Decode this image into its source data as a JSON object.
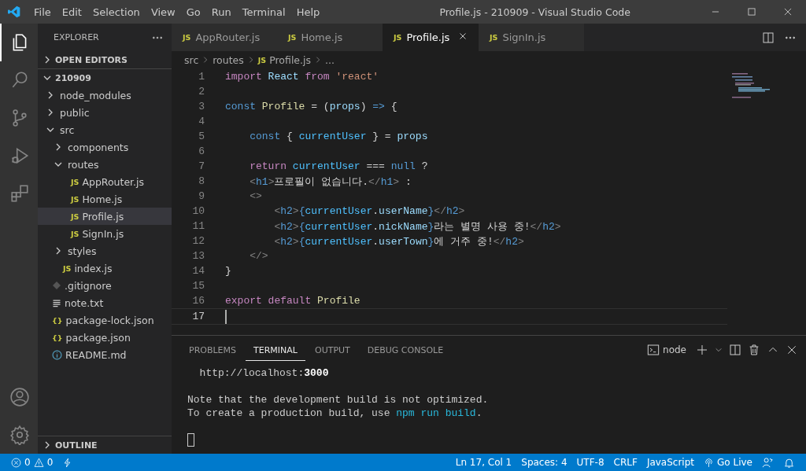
{
  "window": {
    "title": "Profile.js - 210909 - Visual Studio Code"
  },
  "menu": [
    "File",
    "Edit",
    "Selection",
    "View",
    "Go",
    "Run",
    "Terminal",
    "Help"
  ],
  "activity_bar": [
    {
      "kind": "files",
      "selected": true
    },
    {
      "kind": "search",
      "selected": false
    },
    {
      "kind": "source-control",
      "selected": false
    },
    {
      "kind": "run",
      "selected": false
    },
    {
      "kind": "extensions",
      "selected": false
    }
  ],
  "activity_bottom": [
    {
      "kind": "account"
    },
    {
      "kind": "settings"
    }
  ],
  "sidebar": {
    "title": "EXPLORER",
    "sections": [
      {
        "label": "OPEN EDITORS",
        "expanded": false
      }
    ],
    "root": {
      "label": "210909",
      "expanded": true,
      "children": [
        {
          "label": "node_modules",
          "kind": "folder",
          "expanded": false,
          "selected": false
        },
        {
          "label": "public",
          "kind": "folder",
          "expanded": false,
          "selected": false
        },
        {
          "label": "src",
          "kind": "folder",
          "expanded": true,
          "selected": false,
          "children": [
            {
              "label": "components",
              "kind": "folder",
              "expanded": false,
              "selected": false
            },
            {
              "label": "routes",
              "kind": "folder",
              "expanded": true,
              "selected": false,
              "children": [
                {
                  "label": "AppRouter.js",
                  "kind": "js",
                  "badge": "JS",
                  "selected": false
                },
                {
                  "label": "Home.js",
                  "kind": "js",
                  "badge": "JS",
                  "selected": false
                },
                {
                  "label": "Profile.js",
                  "kind": "js",
                  "badge": "JS",
                  "selected": true
                },
                {
                  "label": "SignIn.js",
                  "kind": "js",
                  "badge": "JS",
                  "selected": false
                }
              ]
            },
            {
              "label": "styles",
              "kind": "folder",
              "expanded": false,
              "selected": false
            },
            {
              "label": "index.js",
              "kind": "js",
              "badge": "JS",
              "selected": false
            }
          ]
        },
        {
          "label": ".gitignore",
          "kind": "git",
          "selected": false
        },
        {
          "label": "note.txt",
          "kind": "text",
          "selected": false
        },
        {
          "label": "package-lock.json",
          "kind": "json",
          "badge": "{}",
          "selected": false
        },
        {
          "label": "package.json",
          "kind": "json",
          "badge": "{}",
          "selected": false
        },
        {
          "label": "README.md",
          "kind": "info",
          "selected": false
        }
      ]
    },
    "bottom_sections": [
      {
        "label": "OUTLINE",
        "expanded": false
      }
    ]
  },
  "tabs": [
    {
      "label": "AppRouter.js",
      "badge": "JS",
      "selected": false
    },
    {
      "label": "Home.js",
      "badge": "JS",
      "selected": false
    },
    {
      "label": "Profile.js",
      "badge": "JS",
      "selected": true
    },
    {
      "label": "SignIn.js",
      "badge": "JS",
      "selected": false
    }
  ],
  "breadcrumb": {
    "parts": [
      "src",
      "routes"
    ],
    "file_badge": "JS",
    "file": "Profile.js",
    "tail": "..."
  },
  "code_lines": [
    {
      "number": "1",
      "current": false,
      "tokens": [
        {
          "kind": "keyword",
          "text": "import "
        },
        {
          "kind": "variable",
          "text": "React "
        },
        {
          "kind": "keyword",
          "text": "from "
        },
        {
          "kind": "string",
          "text": "'react'"
        }
      ]
    },
    {
      "number": "2",
      "current": false
    },
    {
      "number": "3",
      "current": false,
      "tokens": [
        {
          "kind": "storage",
          "text": "const "
        },
        {
          "kind": "function",
          "text": "Profile"
        },
        {
          "kind": "plain",
          "text": " = ("
        },
        {
          "kind": "variable",
          "text": "props"
        },
        {
          "kind": "plain",
          "text": ") "
        },
        {
          "kind": "storage",
          "text": "=>"
        },
        {
          "kind": "plain",
          "text": " {"
        }
      ]
    },
    {
      "number": "4",
      "current": false
    },
    {
      "number": "5",
      "current": false,
      "tokens": [
        {
          "kind": "storage",
          "text": "    const"
        },
        {
          "kind": "plain",
          "text": " { "
        },
        {
          "kind": "constant",
          "text": "currentUser"
        },
        {
          "kind": "plain",
          "text": " } = "
        },
        {
          "kind": "variable",
          "text": "props"
        }
      ]
    },
    {
      "number": "6",
      "current": false
    },
    {
      "number": "7",
      "current": false,
      "tokens": [
        {
          "kind": "keyword",
          "text": "    return "
        },
        {
          "kind": "constant",
          "text": "currentUser"
        },
        {
          "kind": "plain",
          "text": " === "
        },
        {
          "kind": "storage",
          "text": "null"
        },
        {
          "kind": "plain",
          "text": " ?"
        }
      ]
    },
    {
      "number": "8",
      "current": false,
      "tokens": [
        {
          "kind": "bracket",
          "text": "    <"
        },
        {
          "kind": "tag",
          "text": "h1"
        },
        {
          "kind": "bracket",
          "text": ">"
        },
        {
          "kind": "plain",
          "text": "프로필이 없습니다."
        },
        {
          "kind": "bracket",
          "text": "</"
        },
        {
          "kind": "tag",
          "text": "h1"
        },
        {
          "kind": "bracket",
          "text": ">"
        },
        {
          "kind": "plain",
          "text": " :"
        }
      ]
    },
    {
      "number": "9",
      "current": false,
      "tokens": [
        {
          "kind": "bracket",
          "text": "    <>"
        }
      ]
    },
    {
      "number": "10",
      "current": false,
      "tokens": [
        {
          "kind": "bracket",
          "text": "        <"
        },
        {
          "kind": "tag",
          "text": "h2"
        },
        {
          "kind": "bracket",
          "text": ">"
        },
        {
          "kind": "storage",
          "text": "{"
        },
        {
          "kind": "constant",
          "text": "currentUser"
        },
        {
          "kind": "plain",
          "text": "."
        },
        {
          "kind": "variable",
          "text": "userName"
        },
        {
          "kind": "storage",
          "text": "}"
        },
        {
          "kind": "bracket",
          "text": "</"
        },
        {
          "kind": "tag",
          "text": "h2"
        },
        {
          "kind": "bracket",
          "text": ">"
        }
      ]
    },
    {
      "number": "11",
      "current": false,
      "tokens": [
        {
          "kind": "bracket",
          "text": "        <"
        },
        {
          "kind": "tag",
          "text": "h2"
        },
        {
          "kind": "bracket",
          "text": ">"
        },
        {
          "kind": "storage",
          "text": "{"
        },
        {
          "kind": "constant",
          "text": "currentUser"
        },
        {
          "kind": "plain",
          "text": "."
        },
        {
          "kind": "variable",
          "text": "nickName"
        },
        {
          "kind": "storage",
          "text": "}"
        },
        {
          "kind": "plain",
          "text": "라는 별명 사용 중!"
        },
        {
          "kind": "bracket",
          "text": "</"
        },
        {
          "kind": "tag",
          "text": "h2"
        },
        {
          "kind": "bracket",
          "text": ">"
        }
      ]
    },
    {
      "number": "12",
      "current": false,
      "tokens": [
        {
          "kind": "bracket",
          "text": "        <"
        },
        {
          "kind": "tag",
          "text": "h2"
        },
        {
          "kind": "bracket",
          "text": ">"
        },
        {
          "kind": "storage",
          "text": "{"
        },
        {
          "kind": "constant",
          "text": "currentUser"
        },
        {
          "kind": "plain",
          "text": "."
        },
        {
          "kind": "variable",
          "text": "userTown"
        },
        {
          "kind": "storage",
          "text": "}"
        },
        {
          "kind": "plain",
          "text": "에 거주 중!"
        },
        {
          "kind": "bracket",
          "text": "</"
        },
        {
          "kind": "tag",
          "text": "h2"
        },
        {
          "kind": "bracket",
          "text": ">"
        }
      ]
    },
    {
      "number": "13",
      "current": false,
      "tokens": [
        {
          "kind": "bracket",
          "text": "    </>"
        }
      ]
    },
    {
      "number": "14",
      "current": false,
      "tokens": [
        {
          "kind": "plain",
          "text": "}"
        }
      ]
    },
    {
      "number": "15",
      "current": false
    },
    {
      "number": "16",
      "current": false,
      "tokens": [
        {
          "kind": "keyword",
          "text": "export default "
        },
        {
          "kind": "function",
          "text": "Profile"
        }
      ]
    },
    {
      "number": "17",
      "current": true
    }
  ],
  "panel": {
    "tabs": [
      {
        "label": "PROBLEMS",
        "selected": false
      },
      {
        "label": "TERMINAL",
        "selected": true
      },
      {
        "label": "OUTPUT",
        "selected": false
      },
      {
        "label": "DEBUG CONSOLE",
        "selected": false
      }
    ],
    "terminal_name": "node",
    "output_blocks": [
      {
        "lines": [
          [
            {
              "kind": "plain",
              "text": "  http://localhost:"
            },
            {
              "kind": "bold",
              "text": "3000"
            }
          ]
        ]
      },
      {
        "lines": [
          [
            {
              "kind": "plain",
              "text": "Note that the development build is not optimized."
            }
          ],
          [
            {
              "kind": "plain",
              "text": "To create a production build, use "
            },
            {
              "kind": "link",
              "text": "npm run build"
            },
            {
              "kind": "plain",
              "text": "."
            }
          ]
        ]
      }
    ]
  },
  "status_bar": {
    "errors": "0",
    "warnings": "0",
    "right": [
      {
        "kind": "text",
        "text": "Ln 17, Col 1"
      },
      {
        "kind": "text",
        "text": "Spaces: 4"
      },
      {
        "kind": "text",
        "text": "UTF-8"
      },
      {
        "kind": "text",
        "text": "CRLF"
      },
      {
        "kind": "text",
        "text": "JavaScript"
      },
      {
        "kind": "live",
        "text": "Go Live"
      }
    ]
  }
}
